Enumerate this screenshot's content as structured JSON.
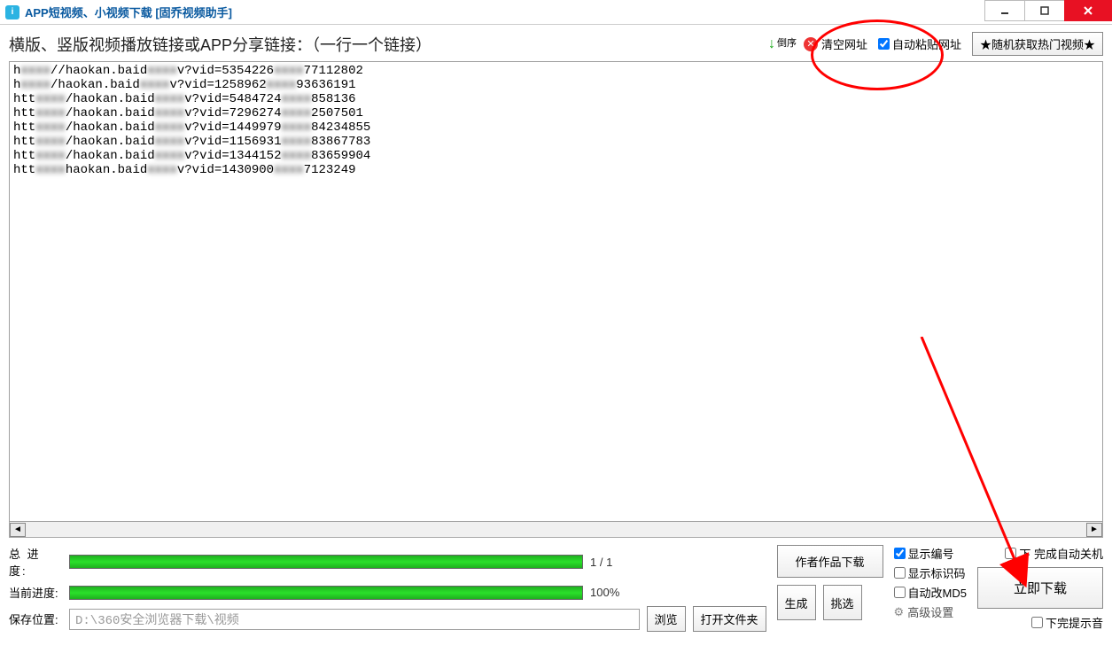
{
  "title": "APP短视频、小视频下载 [固乔视频助手]",
  "instruction": "横版、竖版视频播放链接或APP分享链接：（一行一个链接）",
  "sort_label": "倒序",
  "clear_label": "清空网址",
  "auto_paste_label": "自动粘贴网址",
  "hot_label": "★随机获取热门视频★",
  "urls": [
    {
      "a": "h",
      "b": "//haokan.baid",
      "c": "v?vid=5354226",
      "d": "77112802"
    },
    {
      "a": "h",
      "b": "/haokan.baid",
      "c": "v?vid=1258962",
      "d": "93636191"
    },
    {
      "a": "htt",
      "b": "/haokan.baid",
      "c": "v?vid=5484724",
      "d": "858136"
    },
    {
      "a": "htt",
      "b": "/haokan.baid",
      "c": "v?vid=7296274",
      "d": "2507501"
    },
    {
      "a": "htt",
      "b": "/haokan.baid",
      "c": "v?vid=1449979",
      "d": "84234855"
    },
    {
      "a": "htt",
      "b": "/haokan.baid",
      "c": "v?vid=1156931",
      "d": "83867783"
    },
    {
      "a": "htt",
      "b": "/haokan.baid",
      "c": "v?vid=1344152",
      "d": "83659904"
    },
    {
      "a": "htt",
      "b": "haokan.baid",
      "c": "v?vid=1430900",
      "d": "7123249"
    }
  ],
  "total_progress_label": "总 进 度:",
  "current_progress_label": "当前进度:",
  "total_progress_text": "1 / 1",
  "current_progress_text": "100%",
  "save_label": "保存位置:",
  "save_path": "D:\\360安全浏览器下载\\视频",
  "browse_label": "浏览",
  "open_folder_label": "打开文件夹",
  "author_download_label": "作者作品下载",
  "generate_label": "生成",
  "pick_label": "挑选",
  "show_number_label": "显示编号",
  "show_id_label": "显示标识码",
  "auto_md5_label": "自动改MD5",
  "advanced_label": "高级设置",
  "auto_shutdown_label": "下    完成自动关机",
  "download_now_label": "立即下载",
  "done_sound_label": "下完提示音"
}
